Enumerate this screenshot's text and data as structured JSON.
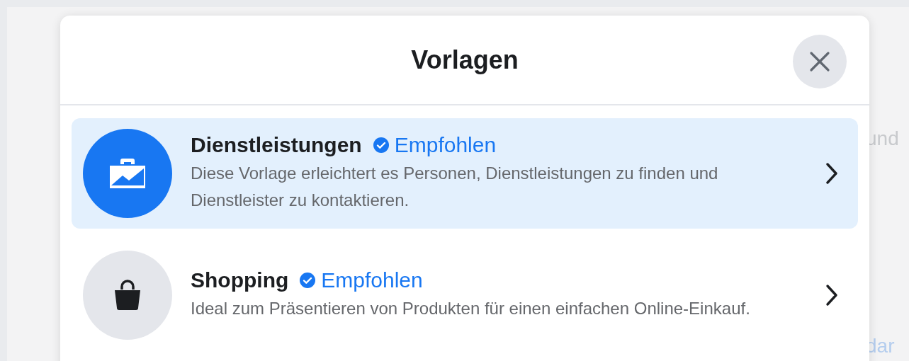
{
  "background": {
    "texts": [
      "und",
      "dar"
    ]
  },
  "dialog": {
    "title": "Vorlagen",
    "templates": [
      {
        "name": "Dienstleistungen",
        "badge": "Empfohlen",
        "description": "Diese Vorlage erleichtert es Personen, Dienstleistungen zu finden und Dienstleister zu kontaktieren.",
        "kind": "services",
        "selected": true
      },
      {
        "name": "Shopping",
        "badge": "Empfohlen",
        "description": "Ideal zum Präsentieren von Produkten für einen einfachen Online-Einkauf.",
        "kind": "shopping",
        "selected": false
      }
    ]
  }
}
